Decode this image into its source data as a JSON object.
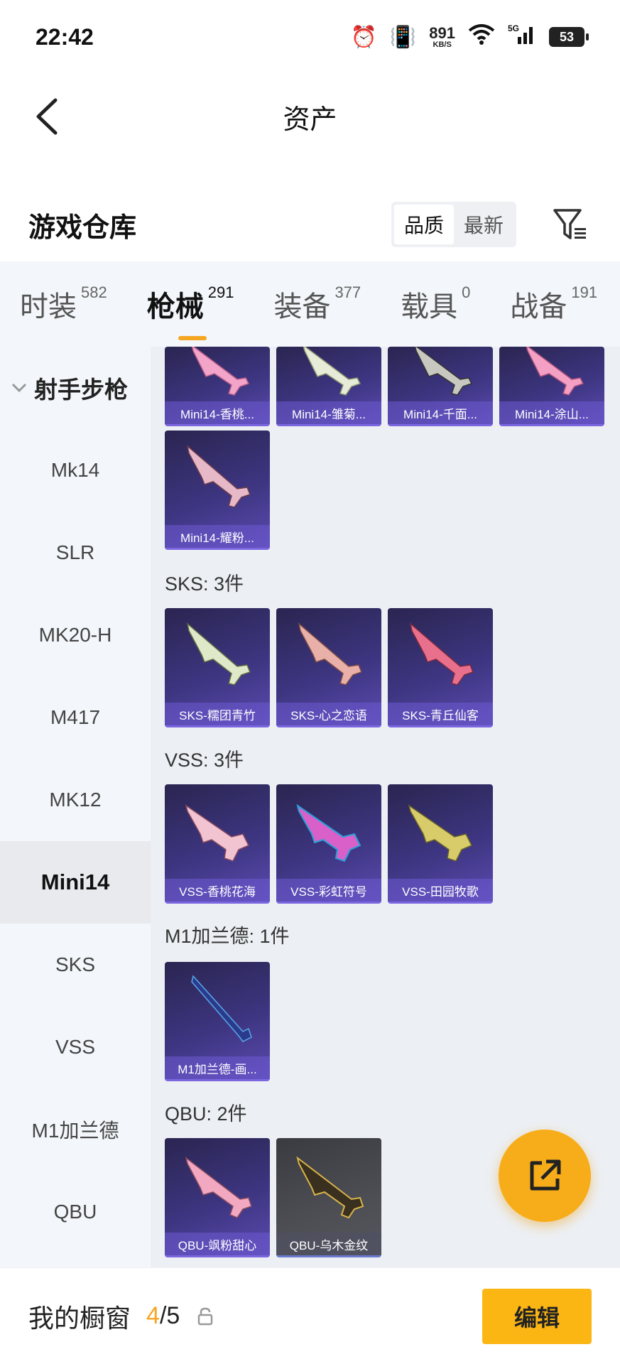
{
  "status_bar": {
    "time": "22:42",
    "net_speed": "891",
    "net_unit": "KB/S",
    "signal": "5G",
    "battery": "53"
  },
  "header": {
    "title": "资产"
  },
  "warehouse": {
    "title": "游戏仓库",
    "sort_quality": "品质",
    "sort_newest": "最新"
  },
  "tabs": [
    {
      "label": "时装",
      "count": "582"
    },
    {
      "label": "枪械",
      "count": "291"
    },
    {
      "label": "装备",
      "count": "377"
    },
    {
      "label": "载具",
      "count": "0"
    },
    {
      "label": "战备",
      "count": "191"
    }
  ],
  "sidebar": {
    "group": "射手步枪",
    "items": [
      "Mk14",
      "SLR",
      "MK20-H",
      "M417",
      "MK12",
      "Mini14",
      "SKS",
      "VSS",
      "M1加兰德",
      "QBU"
    ],
    "active": "Mini14"
  },
  "sections": {
    "mini14_items": [
      "Mini14-香桃...",
      "Mini14-雏菊...",
      "Mini14-千面...",
      "Mini14-涂山...",
      "Mini14-耀粉..."
    ],
    "sks_head": "SKS: 3件",
    "sks_items": [
      "SKS-糯团青竹",
      "SKS-心之恋语",
      "SKS-青丘仙客"
    ],
    "vss_head": "VSS: 3件",
    "vss_items": [
      "VSS-香桃花海",
      "VSS-彩虹符号",
      "VSS-田园牧歌"
    ],
    "m1_head": "M1加兰德: 1件",
    "m1_items": [
      "M1加兰德-画..."
    ],
    "qbu_head": "QBU: 2件",
    "qbu_items": [
      "QBU-飒粉甜心",
      "QBU-乌木金纹"
    ]
  },
  "bottom": {
    "title": "我的橱窗",
    "count_num": "4",
    "count_rest": "/5",
    "edit": "编辑"
  },
  "colors": {
    "accent": "#f5a623",
    "edit_btn": "#fbb614",
    "fab": "#f7ad1a",
    "card_purple": "#3d3580"
  }
}
